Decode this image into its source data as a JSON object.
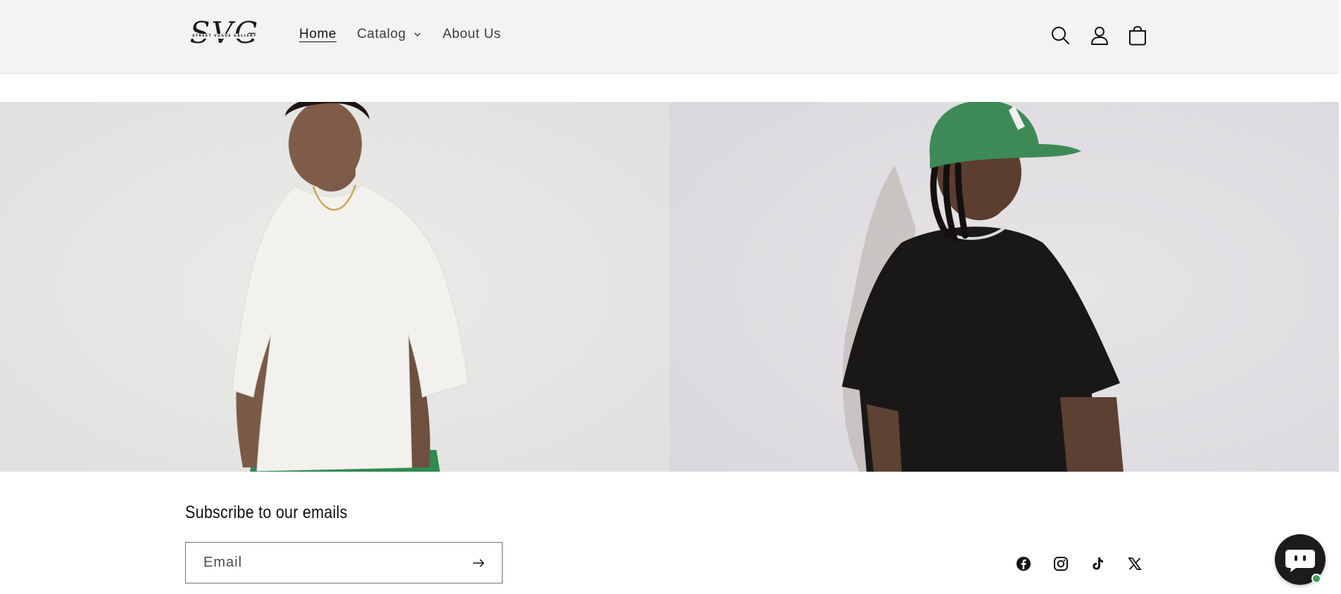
{
  "header": {
    "logo": {
      "mark": "SVG",
      "tagline": "STREET VOGUE GALLERY"
    },
    "nav": [
      {
        "label": "Home",
        "active": true
      },
      {
        "label": "Catalog",
        "has_dropdown": true
      },
      {
        "label": "About Us"
      }
    ],
    "icons": [
      "search-icon",
      "account-icon",
      "cart-icon"
    ]
  },
  "hero": {
    "left_image": "model in white t-shirt and green pants",
    "right_image": "model in green cap and black t-shirt"
  },
  "footer": {
    "subscribe_title": "Subscribe to our emails",
    "email_placeholder": "Email",
    "social": [
      "facebook-icon",
      "instagram-icon",
      "tiktok-icon",
      "x-icon"
    ]
  },
  "chat": {
    "status_color": "#3aa05a"
  },
  "colors": {
    "header_bg": "#f3f3f3",
    "text": "#121212",
    "accent_green": "#3d8a57"
  }
}
